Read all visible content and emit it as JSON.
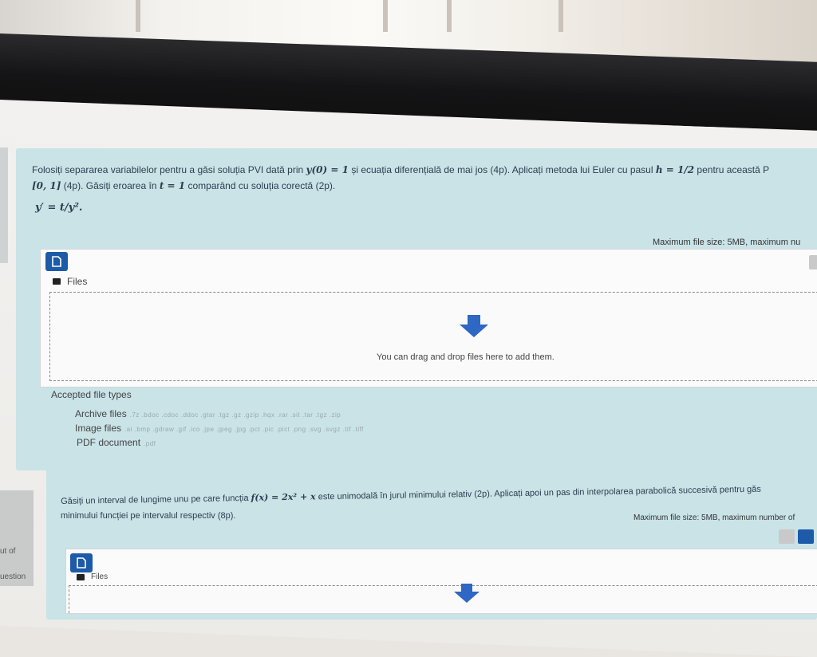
{
  "question1": {
    "line1_prefix": "Folosiți separarea variabilelor pentru a găsi soluția PVI dată prin",
    "line1_ic": "y(0) = 1",
    "line1_middle": "și ecuația diferențială de mai jos (4p). Aplicați metoda lui Euler cu pasul",
    "line1_step": "h = 1/2",
    "line1_suffix": "pentru această P",
    "line2_interval": "[0, 1]",
    "line2_text": "(4p). Găsiți eroarea în",
    "line2_t": "t = 1",
    "line2_suffix": "comparând cu soluția corectă (2p).",
    "equation": "y′ = t/y².",
    "max_size": "Maximum file size: 5MB, maximum nu",
    "files_label": "Files",
    "drop_text": "You can drag and drop files here to add them.",
    "accepted_title": "Accepted file types",
    "file_types": [
      {
        "label": "Archive files",
        "ext": ".7z .bdoc .cdoc .ddoc .gtar .tgz .gz .gzip .hqx .rar .sit .tar .tgz .zip"
      },
      {
        "label": "Image files",
        "ext": ".ai .bmp .gdraw .gif .ico .jpe .jpeg .jpg .pct .pic .pict .png .svg .svgz .tif .tiff"
      },
      {
        "label": "PDF document",
        "ext": ".pdf"
      }
    ]
  },
  "question2": {
    "line1_prefix": "Găsiți un interval de lungime unu pe care funcția",
    "line1_func": "f(x) = 2x² + x",
    "line1_suffix": "este unimodală în jurul minimului relativ (2p). Aplicați apoi un pas din interpolarea parabolică succesivă pentru găs",
    "line2": "minimului funcției pe intervalul respectiv (8p).",
    "max_size": "Maximum file size: 5MB, maximum number of",
    "files_label": "Files"
  },
  "side": {
    "text1": "ut of",
    "text2": "uestion"
  }
}
